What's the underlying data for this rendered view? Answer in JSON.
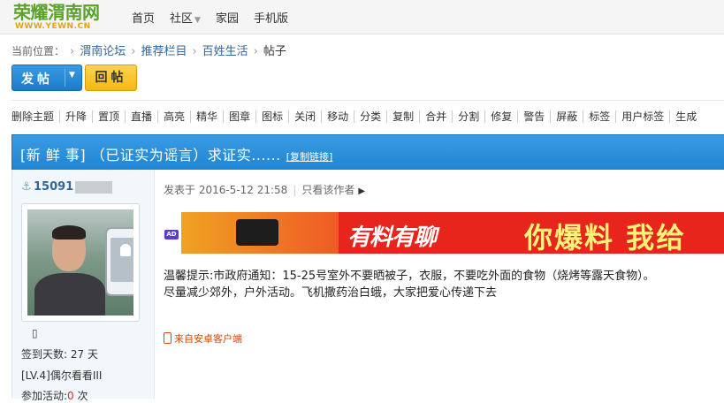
{
  "logo": {
    "cn": "荣耀渭南网",
    "en": "WWW.YEWN.CN"
  },
  "nav": [
    {
      "label": "首页"
    },
    {
      "label": "社区"
    },
    {
      "label": "家园"
    },
    {
      "label": "手机版"
    }
  ],
  "breadcrumb": {
    "prefix": "当前位置：",
    "items": [
      "渭南论坛",
      "推荐栏目",
      "百姓生活",
      "帖子"
    ]
  },
  "buttons": {
    "post": "发帖",
    "reply": "回帖"
  },
  "mod_tools": [
    "删除主题",
    "升降",
    "置顶",
    "直播",
    "高亮",
    "精华",
    "图章",
    "图标",
    "关闭",
    "移动",
    "分类",
    "复制",
    "合并",
    "分割",
    "修复",
    "警告",
    "屏蔽",
    "标签",
    "用户标签",
    "生成"
  ],
  "thread": {
    "title": "[新 鲜 事] （已证实为谣言）求证实......",
    "copy_link": "[复制链接]"
  },
  "author": {
    "name_visible": "15091",
    "checkin_label": "签到天数: ",
    "checkin_value": "27 天",
    "level": "[LV.4]偶尔看看III",
    "activity_label": "参加活动:",
    "activity_value": "0",
    "activity_unit": " 次"
  },
  "post": {
    "posted_at": "发表于 2016-5-12 21:58",
    "only_author": "只看该作者",
    "ad_badge": "AD",
    "banner_slogan": "有料有聊",
    "banner_cta": "你爆料 我给",
    "lines": [
      "温馨提示:市政府通知：15-25号室外不要晒被子，衣服，不要吃外面的食物（烧烤等露天食物）。",
      "尽量减少郊外，户外活动。飞机撒药治白蛾，大家把爱心传递下去"
    ],
    "source": "来自安卓客户端"
  }
}
